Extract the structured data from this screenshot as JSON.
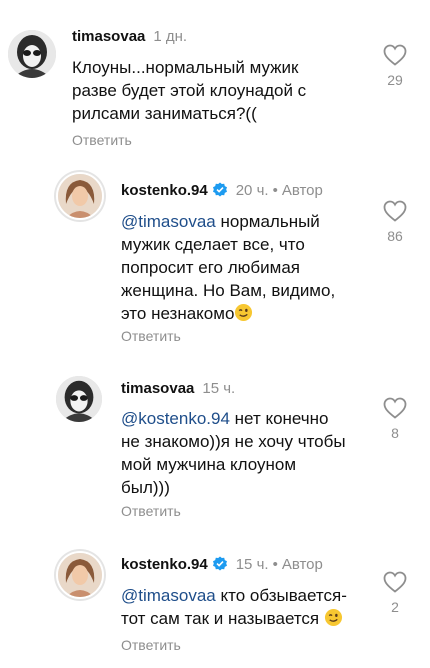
{
  "comments": [
    {
      "username": "timasovaa",
      "time": "1 дн.",
      "lines": [
        "Клоуны...нормальный мужик",
        "разве будет этой клоунадой с",
        "рилсами заниматься?(("
      ],
      "reply_label": "Ответить",
      "likes": "29"
    },
    {
      "username": "kostenko.94",
      "time": "20 ч.",
      "author_label": "Автор",
      "mention": "@timasovaa",
      "lines": [
        " нормальный",
        "мужик сделает все, что",
        "попросит его любимая",
        "женщина. Но Вам, видимо,",
        "это незнакомо"
      ],
      "reply_label": "Ответить",
      "likes": "86"
    },
    {
      "username": "timasovaa",
      "time": "15 ч.",
      "mention": "@kostenko.94",
      "lines": [
        " нет конечно",
        "не знакомо))я не хочу чтобы",
        "мой мужчина клоуном",
        "был)))"
      ],
      "reply_label": "Ответить",
      "likes": "8"
    },
    {
      "username": "kostenko.94",
      "time": "15 ч.",
      "author_label": "Автор",
      "mention": "@timasovaa",
      "lines": [
        " кто обзывается-",
        "тот сам так и называется "
      ],
      "reply_label": "Ответить",
      "likes": "2"
    }
  ],
  "colors": {
    "text": "#111111",
    "secondary": "#8e8e8e",
    "mention": "#1f4e8a",
    "verified": "#1d9bf0"
  },
  "icons": {
    "like": "heart-outline-icon",
    "verified": "verified-badge-icon",
    "emoji": "winking-face-emoji"
  }
}
